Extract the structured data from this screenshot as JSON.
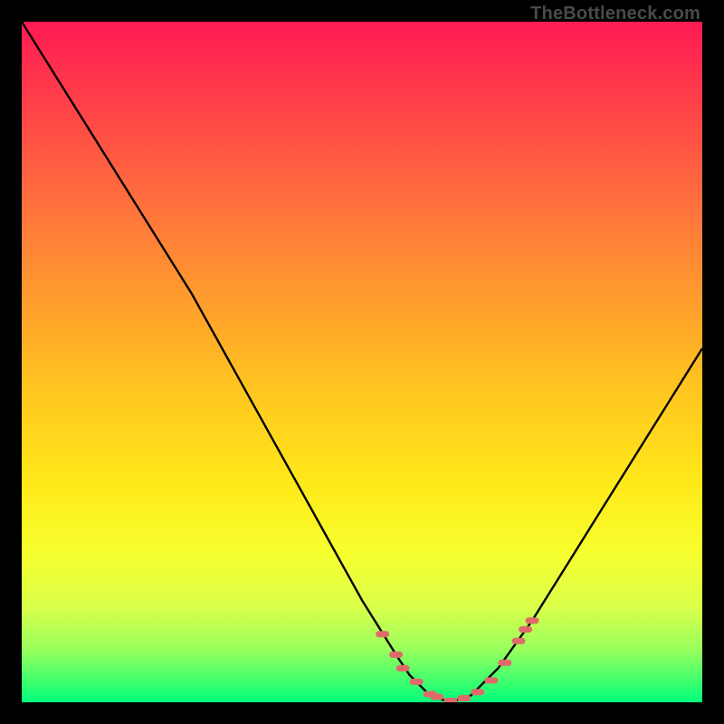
{
  "watermark": "TheBottleneck.com",
  "chart_data": {
    "type": "line",
    "title": "",
    "xlabel": "",
    "ylabel": "",
    "xlim": [
      0,
      100
    ],
    "ylim": [
      0,
      100
    ],
    "series": [
      {
        "name": "curve",
        "x": [
          0,
          5,
          10,
          15,
          20,
          25,
          30,
          35,
          40,
          45,
          50,
          55,
          57,
          60,
          63,
          66,
          70,
          75,
          80,
          85,
          90,
          95,
          100
        ],
        "y": [
          100,
          92,
          84,
          76,
          68,
          60,
          51,
          42,
          33,
          24,
          15,
          7,
          4,
          1,
          0,
          1,
          5,
          12,
          20,
          28,
          36,
          44,
          52
        ]
      }
    ],
    "markers": {
      "name": "highlight-dots",
      "x": [
        53,
        55,
        56,
        58,
        60,
        61,
        63,
        65,
        67,
        69,
        71,
        73,
        74,
        75
      ],
      "y": [
        10,
        7,
        5,
        3,
        1.2,
        0.8,
        0.2,
        0.6,
        1.5,
        3.2,
        5.8,
        9,
        10.7,
        12
      ]
    },
    "annotations": []
  },
  "colors": {
    "curve": "#000000",
    "markers": "#e06a6a",
    "background_top": "#ff1a54",
    "background_bottom": "#00ff7a",
    "frame": "#000000"
  }
}
